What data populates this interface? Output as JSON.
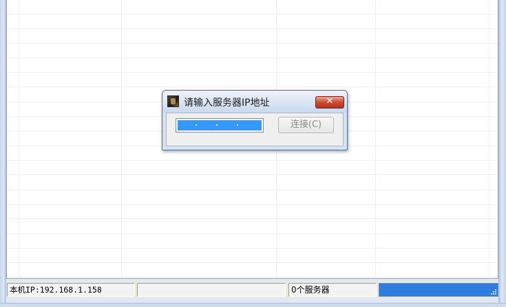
{
  "dialog": {
    "title": "请输入服务器IP地址",
    "close_label": "✕",
    "connect_button_label": "连接(C)",
    "ip_input_value": ""
  },
  "statusbar": {
    "local_ip_label": "本机IP:192.168.1.158",
    "middle_text": "",
    "server_count_label": "0个服务器"
  },
  "icons": {
    "app": "app-icon",
    "close": "close-icon",
    "size_grip": "size-grip-icon"
  },
  "colors": {
    "selection": "#3399ff",
    "close_button": "#cc4a33",
    "progress": "#2f7ce0"
  }
}
